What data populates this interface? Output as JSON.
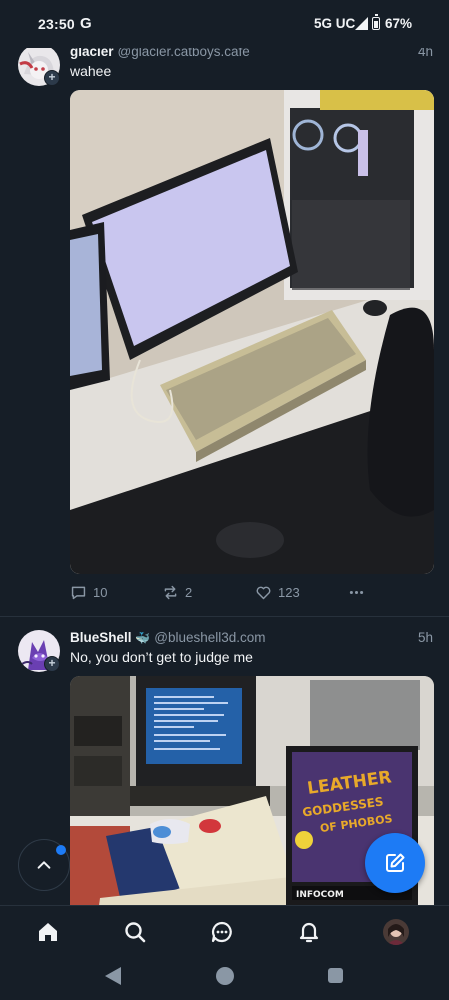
{
  "status_bar": {
    "time": "23:50",
    "g_glyph": "G",
    "network": "5G UC",
    "battery": "67%"
  },
  "posts": [
    {
      "name": "glacier",
      "handle": "@glacier.catboys.cafe",
      "time_ago": "4h",
      "text": "wahee",
      "image_description_icon": "photo-desk-monitor-keyboard",
      "reply_count": "10",
      "repost_count": "2",
      "like_count": "123"
    },
    {
      "name": "BlueShell",
      "emoji_glyph": "🐳",
      "handle": "@blueshell3d.com",
      "time_ago": "5h",
      "text": "No, you don’t get to judge me",
      "image_description_icon": "photo-retro-computer-game-box"
    }
  ],
  "colors": {
    "background": "#161e27",
    "accent": "#1d7bf5",
    "muted": "#8a97a5",
    "divider": "#27313c"
  },
  "nav": {
    "items": [
      "home-icon",
      "search-icon",
      "chat-icon",
      "bell-icon",
      "profile-avatar"
    ]
  }
}
